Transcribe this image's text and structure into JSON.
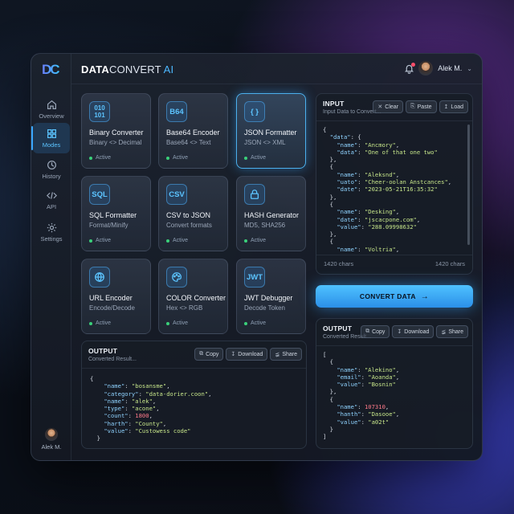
{
  "brand": {
    "part1": "DATA",
    "part2": "CONVERT",
    "part3": " AI",
    "logo_text": "DC"
  },
  "user": {
    "name": "Alek M."
  },
  "sidebar": {
    "items": [
      {
        "label": "Overview",
        "icon": "home-icon"
      },
      {
        "label": "Modes",
        "icon": "grid-icon",
        "active": true
      },
      {
        "label": "History",
        "icon": "history-icon"
      },
      {
        "label": "API",
        "icon": "code-icon"
      },
      {
        "label": "Settings",
        "icon": "gear-icon"
      }
    ],
    "user_name": "Alek M."
  },
  "tools": [
    {
      "icon_text": "010 101",
      "title": "Binary Converter",
      "sub": "Binary <> Decimal",
      "status": "Active"
    },
    {
      "icon_text": "B64",
      "title": "Base64 Encoder",
      "sub": "Base64 <> Text",
      "status": "Active"
    },
    {
      "icon_text": "{ }",
      "title": "JSON Formatter",
      "sub": "JSON <> XML",
      "status": "Active",
      "selected": true
    },
    {
      "icon_text": "SQL",
      "title": "SQL Formatter",
      "sub": "Format/Minify",
      "status": "Active"
    },
    {
      "icon_text": "CSV",
      "title": "CSV to JSON",
      "sub": "Convert formats",
      "status": "Active"
    },
    {
      "icon_text": "lock-icon",
      "title": "HASH Generator",
      "sub": "MD5, SHA256",
      "status": "Active"
    },
    {
      "icon_text": "globe-icon",
      "title": "URL Encoder",
      "sub": "Encode/Decode",
      "status": "Active"
    },
    {
      "icon_text": "palette-icon",
      "title": "COLOR Converter",
      "sub": "Hex <> RGB",
      "status": "Active"
    },
    {
      "icon_text": "JWT",
      "title": "JWT Debugger",
      "sub": "Decode Token",
      "status": "Active"
    }
  ],
  "input_panel": {
    "title": "INPUT",
    "subtitle": "Input Data to Convert...",
    "buttons": {
      "clear": "Clear",
      "paste": "Paste",
      "load": "Load"
    },
    "char_left": "1420 chars",
    "char_right": "1420 chars",
    "lines": [
      "{",
      "  \"data\": {",
      "    \"name\": \"Ancmory\",",
      "    \"data\": \"One of that one two\"",
      "  },",
      "  {",
      "    \"name\": \"Aleksnd\",",
      "    \"uato\": \"Cheer-oolan Anstcances\",",
      "    \"date\": \"2023-05-21T16:35:32\"",
      "  },",
      "  {",
      "    \"name\": \"Desking\",",
      "    \"date\": \"jscacpone.com\",",
      "    \"value\": \"288.09998632\"",
      "  },",
      "  {",
      "    \"name\": \"Voltria\","
    ]
  },
  "convert_button": {
    "label": "CONVERT DATA",
    "arrow": "→"
  },
  "output_right": {
    "title": "OUTPUT",
    "subtitle": "Converted Result...",
    "buttons": {
      "copy": "Copy",
      "download": "Download",
      "share": "Share"
    },
    "lines": [
      "[",
      "  {",
      "    \"name\": \"Alekino\",",
      "    \"email\": \"Aoanda\",",
      "    \"value\": \"Bosnin\"",
      "  },",
      "  {",
      "    \"name\": 107310,",
      "    \"hanth\": \"Dasooe\",",
      "    \"value\": \"a02t\"",
      "  }",
      "]"
    ]
  },
  "output_bottom": {
    "title": "OUTPUT",
    "subtitle": "Converted Result...",
    "buttons": {
      "copy": "Copy",
      "download": "Download",
      "share": "Share"
    },
    "lines": [
      "{",
      "    \"name\": \"bosansme\",",
      "    \"category\": \"data-dorier.coon\",",
      "    \"name\": \"alek\",",
      "    \"type\": \"acone\",",
      "    \"count\": 1800,",
      "    \"harth\": \"County\",",
      "    \"value\": \"Custowess code\"",
      "  }"
    ]
  },
  "colors": {
    "accent": "#3aa8ff",
    "active_status": "#3ad07a",
    "json_key": "#8fd3ff",
    "json_string": "#c6e58a",
    "json_number": "#ff7a8a"
  }
}
